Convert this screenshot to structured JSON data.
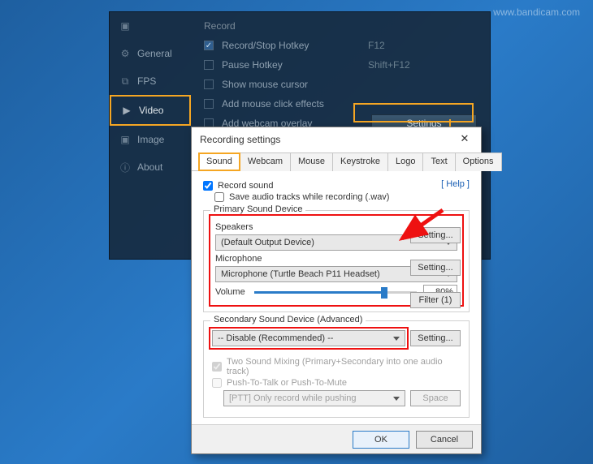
{
  "watermark": "www.bandicam.com",
  "sidebar": {
    "items": [
      {
        "label": ""
      },
      {
        "label": "General"
      },
      {
        "label": "FPS"
      },
      {
        "label": "Video"
      },
      {
        "label": "Image"
      },
      {
        "label": "About"
      }
    ]
  },
  "record": {
    "title": "Record",
    "rows": [
      {
        "label": "Record/Stop Hotkey",
        "value": "F12",
        "checked": true
      },
      {
        "label": "Pause Hotkey",
        "value": "Shift+F12",
        "checked": false
      },
      {
        "label": "Show mouse cursor",
        "value": "",
        "checked": false
      },
      {
        "label": "Add mouse click effects",
        "value": "",
        "checked": false
      },
      {
        "label": "Add webcam overlay",
        "value": "",
        "checked": false
      }
    ],
    "settings_btn": "Settings"
  },
  "dialog": {
    "title": "Recording settings",
    "tabs": [
      "Sound",
      "Webcam",
      "Mouse",
      "Keystroke",
      "Logo",
      "Text",
      "Options"
    ],
    "record_sound": "Record sound",
    "save_wav": "Save audio tracks while recording (.wav)",
    "help": "[ Help ]",
    "primary": {
      "legend": "Primary Sound Device",
      "speakers_label": "Speakers",
      "speakers_value": "(Default Output Device)",
      "speakers_btn": "Setting...",
      "mic_label": "Microphone",
      "mic_value": "Microphone (Turtle Beach P11 Headset)",
      "mic_btn": "Setting...",
      "volume_label": "Volume",
      "volume_pct": "80%",
      "volume_value": 80,
      "filter_btn": "Filter (1)"
    },
    "secondary": {
      "legend": "Secondary Sound Device (Advanced)",
      "value": "-- Disable (Recommended) --",
      "btn": "Setting..."
    },
    "mixing": {
      "two_mix": "Two Sound Mixing (Primary+Secondary into one audio track)",
      "ptt": "Push-To-Talk or Push-To-Mute",
      "ptt_value": "[PTT] Only record while pushing",
      "ptt_key": "Space"
    },
    "ok": "OK",
    "cancel": "Cancel"
  }
}
